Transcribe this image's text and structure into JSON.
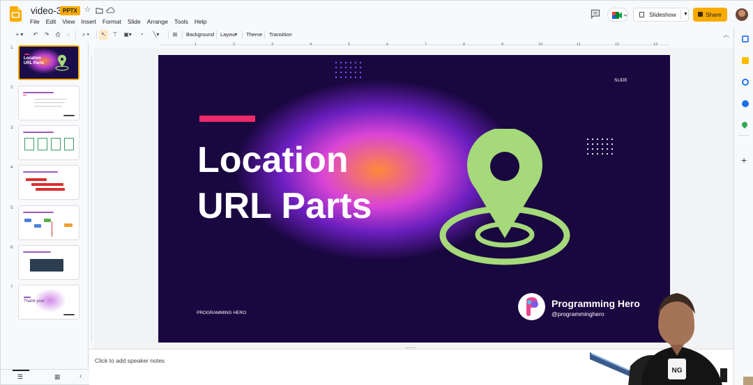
{
  "doc": {
    "title": "video-3",
    "badge": "PPTX"
  },
  "menu": [
    "File",
    "Edit",
    "View",
    "Insert",
    "Format",
    "Slide",
    "Arrange",
    "Tools",
    "Help"
  ],
  "header_buttons": {
    "slideshow": "Slideshow",
    "share": "Share"
  },
  "toolbar": {
    "background": "Background",
    "layout": "Layout",
    "theme": "Theme",
    "transition": "Transition"
  },
  "ruler_top": [
    "1",
    "2",
    "3",
    "4",
    "5",
    "6",
    "7",
    "8",
    "9",
    "10",
    "11",
    "12",
    "13"
  ],
  "filmstrip": [
    {
      "num": "1",
      "text": "Location URL Parts"
    },
    {
      "num": "2",
      "text": ""
    },
    {
      "num": "3",
      "text": ""
    },
    {
      "num": "4",
      "text": ""
    },
    {
      "num": "5",
      "text": ""
    },
    {
      "num": "6",
      "text": ""
    },
    {
      "num": "7",
      "text": "Thank you!"
    }
  ],
  "slide": {
    "title_line1": "Location",
    "title_line2": "URL Parts",
    "corner_label": "SLIDE",
    "brand_small": "PROGRAMMING HERO",
    "brand_name": "Programming Hero",
    "brand_handle": "@programminghero"
  },
  "notes": {
    "placeholder": "Click to add speaker notes"
  },
  "colors": {
    "accent": "#f9ab00",
    "slide_bg": "#19073f",
    "pin": "#a5d97a",
    "pink": "#ee2a6b"
  },
  "icons": [
    "slides-logo-icon",
    "star-icon",
    "move-icon",
    "cloud-icon",
    "comment-icon",
    "meet-icon",
    "present-icon",
    "lock-icon",
    "new-slide-icon",
    "undo-icon",
    "redo-icon",
    "print-icon",
    "paint-format-icon",
    "zoom-icon",
    "select-icon",
    "textbox-icon",
    "image-icon",
    "shape-icon",
    "line-icon",
    "comment-add-icon",
    "location-pin-icon",
    "dot-grid-icon",
    "keep-icon",
    "tasks-icon",
    "contacts-icon",
    "maps-icon",
    "add-icon",
    "list-view-icon",
    "grid-view-icon",
    "chevron-left-icon"
  ]
}
